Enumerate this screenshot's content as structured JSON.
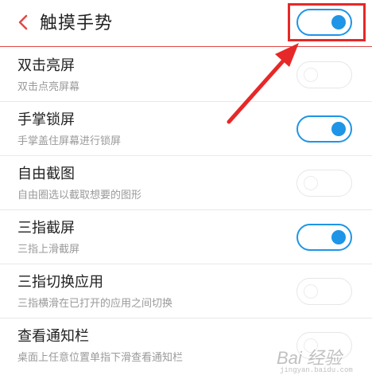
{
  "header": {
    "title": "触摸手势",
    "toggle_on": true
  },
  "items": [
    {
      "title": "双击亮屏",
      "subtitle": "双击点亮屏幕",
      "on": false
    },
    {
      "title": "手掌锁屏",
      "subtitle": "手掌盖住屏幕进行锁屏",
      "on": true
    },
    {
      "title": "自由截图",
      "subtitle": "自由圈选以截取想要的图形",
      "on": false
    },
    {
      "title": "三指截屏",
      "subtitle": "三指上滑截屏",
      "on": true
    },
    {
      "title": "三指切换应用",
      "subtitle": "三指横滑在已打开的应用之间切换",
      "on": false
    },
    {
      "title": "查看通知栏",
      "subtitle": "桌面上任意位置单指下滑查看通知栏",
      "on": false
    }
  ],
  "colors": {
    "accent": "#1e95e6",
    "annotation_red": "#e62828",
    "header_line": "#e24848"
  },
  "watermark": {
    "main": "Bai 经验",
    "sub": "jingyan.baidu.com"
  }
}
